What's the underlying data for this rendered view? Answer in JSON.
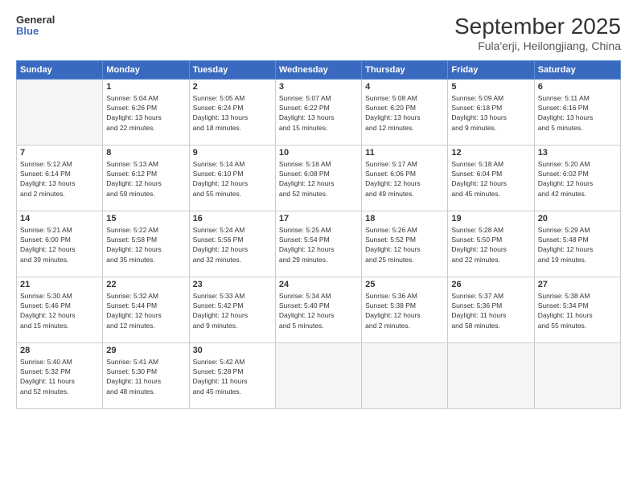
{
  "logo": {
    "line1": "General",
    "line2": "Blue"
  },
  "title": "September 2025",
  "subtitle": "Fula'erji, Heilongjiang, China",
  "header_days": [
    "Sunday",
    "Monday",
    "Tuesday",
    "Wednesday",
    "Thursday",
    "Friday",
    "Saturday"
  ],
  "weeks": [
    [
      {
        "day": "",
        "info": ""
      },
      {
        "day": "1",
        "info": "Sunrise: 5:04 AM\nSunset: 6:26 PM\nDaylight: 13 hours\nand 22 minutes."
      },
      {
        "day": "2",
        "info": "Sunrise: 5:05 AM\nSunset: 6:24 PM\nDaylight: 13 hours\nand 18 minutes."
      },
      {
        "day": "3",
        "info": "Sunrise: 5:07 AM\nSunset: 6:22 PM\nDaylight: 13 hours\nand 15 minutes."
      },
      {
        "day": "4",
        "info": "Sunrise: 5:08 AM\nSunset: 6:20 PM\nDaylight: 13 hours\nand 12 minutes."
      },
      {
        "day": "5",
        "info": "Sunrise: 5:09 AM\nSunset: 6:18 PM\nDaylight: 13 hours\nand 9 minutes."
      },
      {
        "day": "6",
        "info": "Sunrise: 5:11 AM\nSunset: 6:16 PM\nDaylight: 13 hours\nand 5 minutes."
      }
    ],
    [
      {
        "day": "7",
        "info": "Sunrise: 5:12 AM\nSunset: 6:14 PM\nDaylight: 13 hours\nand 2 minutes."
      },
      {
        "day": "8",
        "info": "Sunrise: 5:13 AM\nSunset: 6:12 PM\nDaylight: 12 hours\nand 59 minutes."
      },
      {
        "day": "9",
        "info": "Sunrise: 5:14 AM\nSunset: 6:10 PM\nDaylight: 12 hours\nand 55 minutes."
      },
      {
        "day": "10",
        "info": "Sunrise: 5:16 AM\nSunset: 6:08 PM\nDaylight: 12 hours\nand 52 minutes."
      },
      {
        "day": "11",
        "info": "Sunrise: 5:17 AM\nSunset: 6:06 PM\nDaylight: 12 hours\nand 49 minutes."
      },
      {
        "day": "12",
        "info": "Sunrise: 5:18 AM\nSunset: 6:04 PM\nDaylight: 12 hours\nand 45 minutes."
      },
      {
        "day": "13",
        "info": "Sunrise: 5:20 AM\nSunset: 6:02 PM\nDaylight: 12 hours\nand 42 minutes."
      }
    ],
    [
      {
        "day": "14",
        "info": "Sunrise: 5:21 AM\nSunset: 6:00 PM\nDaylight: 12 hours\nand 39 minutes."
      },
      {
        "day": "15",
        "info": "Sunrise: 5:22 AM\nSunset: 5:58 PM\nDaylight: 12 hours\nand 35 minutes."
      },
      {
        "day": "16",
        "info": "Sunrise: 5:24 AM\nSunset: 5:56 PM\nDaylight: 12 hours\nand 32 minutes."
      },
      {
        "day": "17",
        "info": "Sunrise: 5:25 AM\nSunset: 5:54 PM\nDaylight: 12 hours\nand 29 minutes."
      },
      {
        "day": "18",
        "info": "Sunrise: 5:26 AM\nSunset: 5:52 PM\nDaylight: 12 hours\nand 25 minutes."
      },
      {
        "day": "19",
        "info": "Sunrise: 5:28 AM\nSunset: 5:50 PM\nDaylight: 12 hours\nand 22 minutes."
      },
      {
        "day": "20",
        "info": "Sunrise: 5:29 AM\nSunset: 5:48 PM\nDaylight: 12 hours\nand 19 minutes."
      }
    ],
    [
      {
        "day": "21",
        "info": "Sunrise: 5:30 AM\nSunset: 5:46 PM\nDaylight: 12 hours\nand 15 minutes."
      },
      {
        "day": "22",
        "info": "Sunrise: 5:32 AM\nSunset: 5:44 PM\nDaylight: 12 hours\nand 12 minutes."
      },
      {
        "day": "23",
        "info": "Sunrise: 5:33 AM\nSunset: 5:42 PM\nDaylight: 12 hours\nand 9 minutes."
      },
      {
        "day": "24",
        "info": "Sunrise: 5:34 AM\nSunset: 5:40 PM\nDaylight: 12 hours\nand 5 minutes."
      },
      {
        "day": "25",
        "info": "Sunrise: 5:36 AM\nSunset: 5:38 PM\nDaylight: 12 hours\nand 2 minutes."
      },
      {
        "day": "26",
        "info": "Sunrise: 5:37 AM\nSunset: 5:36 PM\nDaylight: 11 hours\nand 58 minutes."
      },
      {
        "day": "27",
        "info": "Sunrise: 5:38 AM\nSunset: 5:34 PM\nDaylight: 11 hours\nand 55 minutes."
      }
    ],
    [
      {
        "day": "28",
        "info": "Sunrise: 5:40 AM\nSunset: 5:32 PM\nDaylight: 11 hours\nand 52 minutes."
      },
      {
        "day": "29",
        "info": "Sunrise: 5:41 AM\nSunset: 5:30 PM\nDaylight: 11 hours\nand 48 minutes."
      },
      {
        "day": "30",
        "info": "Sunrise: 5:42 AM\nSunset: 5:28 PM\nDaylight: 11 hours\nand 45 minutes."
      },
      {
        "day": "",
        "info": ""
      },
      {
        "day": "",
        "info": ""
      },
      {
        "day": "",
        "info": ""
      },
      {
        "day": "",
        "info": ""
      }
    ]
  ]
}
